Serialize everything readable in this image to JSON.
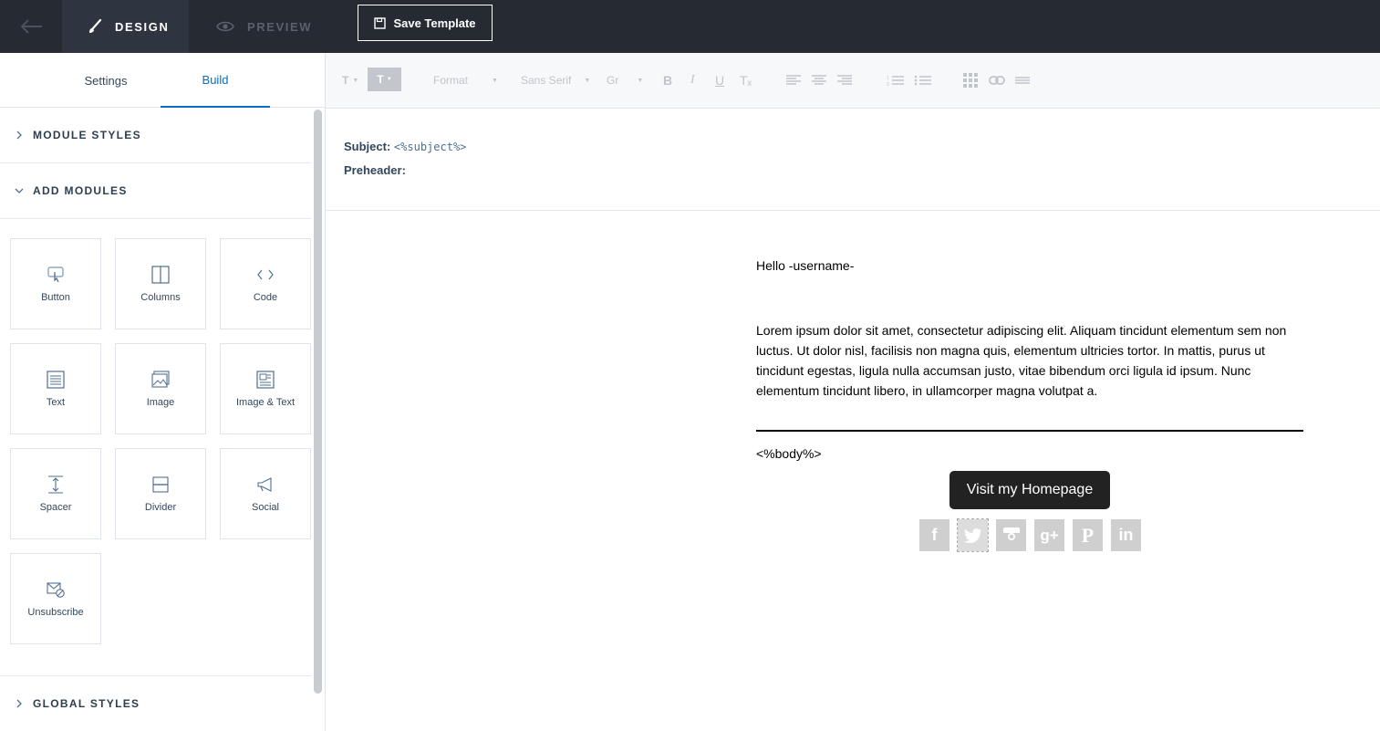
{
  "topbar": {
    "design_label": "DESIGN",
    "preview_label": "PREVIEW",
    "save_label": "Save Template"
  },
  "panel": {
    "tabs": [
      {
        "label": "Settings",
        "active": false
      },
      {
        "label": "Build",
        "active": true
      }
    ],
    "sections": {
      "module_styles": "MODULE STYLES",
      "add_modules": "ADD MODULES",
      "global_styles": "GLOBAL STYLES"
    },
    "modules": [
      {
        "label": "Button",
        "icon": "hand-pointer-icon"
      },
      {
        "label": "Columns",
        "icon": "columns-icon"
      },
      {
        "label": "Code",
        "icon": "code-icon"
      },
      {
        "label": "Text",
        "icon": "text-lines-icon"
      },
      {
        "label": "Image",
        "icon": "image-icon"
      },
      {
        "label": "Image & Text",
        "icon": "image-text-icon"
      },
      {
        "label": "Spacer",
        "icon": "spacer-icon"
      },
      {
        "label": "Divider",
        "icon": "divider-icon"
      },
      {
        "label": "Social",
        "icon": "megaphone-icon"
      },
      {
        "label": "Unsubscribe",
        "icon": "unsubscribe-icon"
      }
    ]
  },
  "toolbar": {
    "format_label": "Format",
    "font_label": "Sans Serif",
    "size_label": "Gr"
  },
  "email": {
    "subject_label": "Subject:",
    "subject_value": "<%subject%>",
    "preheader_label": "Preheader:",
    "greeting": "Hello -username-",
    "body_text": "Lorem ipsum dolor sit amet, consectetur adipiscing elit. Aliquam tincidunt elementum sem non luctus. Ut dolor nisl, facilisis non magna quis, elementum ultricies tortor. In mattis, purus ut tincidunt egestas, ligula nulla accumsan justo, vitae bibendum orci ligula id ipsum. Nunc elementum tincidunt libero, in ullamcorper magna volutpat a.",
    "body_token": "<%body%>",
    "cta_label": "Visit my Homepage",
    "social_icons": [
      "facebook-icon",
      "twitter-icon",
      "instagram-icon",
      "google-plus-icon",
      "pinterest-icon",
      "linkedin-icon"
    ]
  },
  "colors": {
    "topbar_bg": "#252a33",
    "accent": "#0b6dbd",
    "cta_bg": "#222222"
  }
}
